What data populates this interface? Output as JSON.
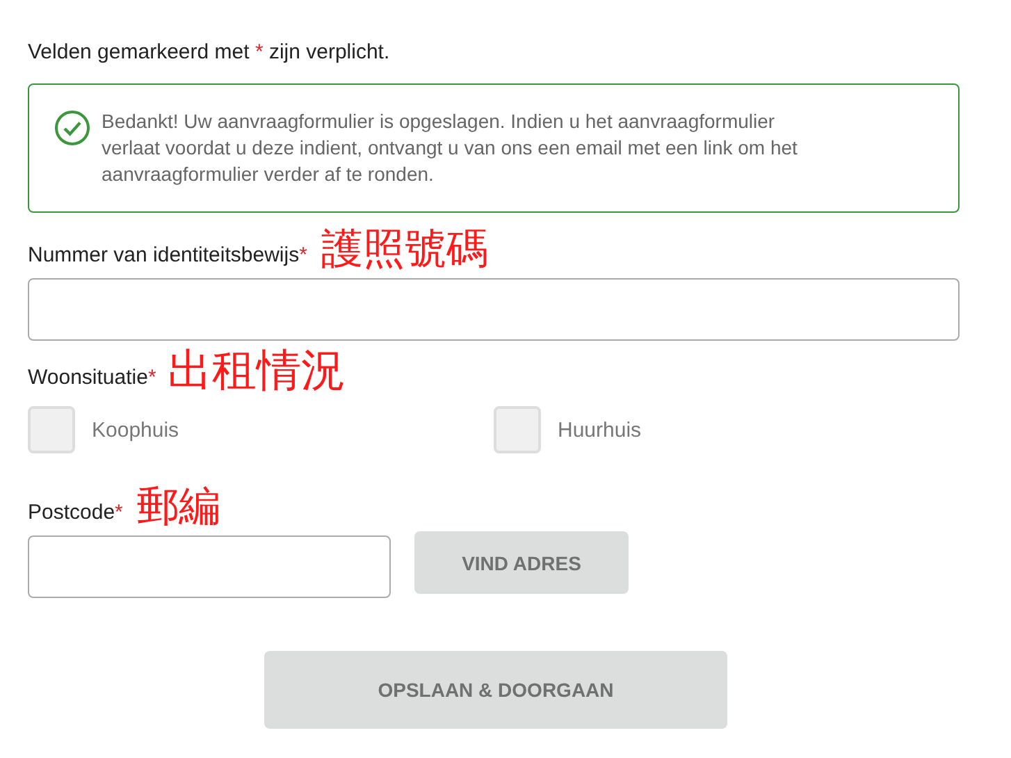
{
  "intro": {
    "before": "Velden gemarkeerd met",
    "mark": "*",
    "after": "zijn verplicht."
  },
  "alert": {
    "kind": "success",
    "text": "Bedankt! Uw aanvraagformulier is opgeslagen. Indien u het aanvraagformulier verlaat voordat u deze indient, ontvangt u van ons een email met een link om het aanvraagformulier verder af te ronden."
  },
  "id_field": {
    "label": "Nummer van identiteitsbewijs",
    "required_mark": "*",
    "annotation": "護照號碼"
  },
  "housing": {
    "label": "Woonsituatie",
    "required_mark": "*",
    "annotation": "出租情況",
    "options": [
      {
        "label": "Koophuis",
        "checked": false
      },
      {
        "label": "Huurhuis",
        "checked": false
      }
    ]
  },
  "postcode": {
    "label": "Postcode",
    "required_mark": "*",
    "annotation": "郵編",
    "button": {
      "label": "VIND ADRES",
      "disabled": true
    }
  },
  "submit": {
    "label": "OPSLAAN & DOORGAAN",
    "disabled": true
  }
}
